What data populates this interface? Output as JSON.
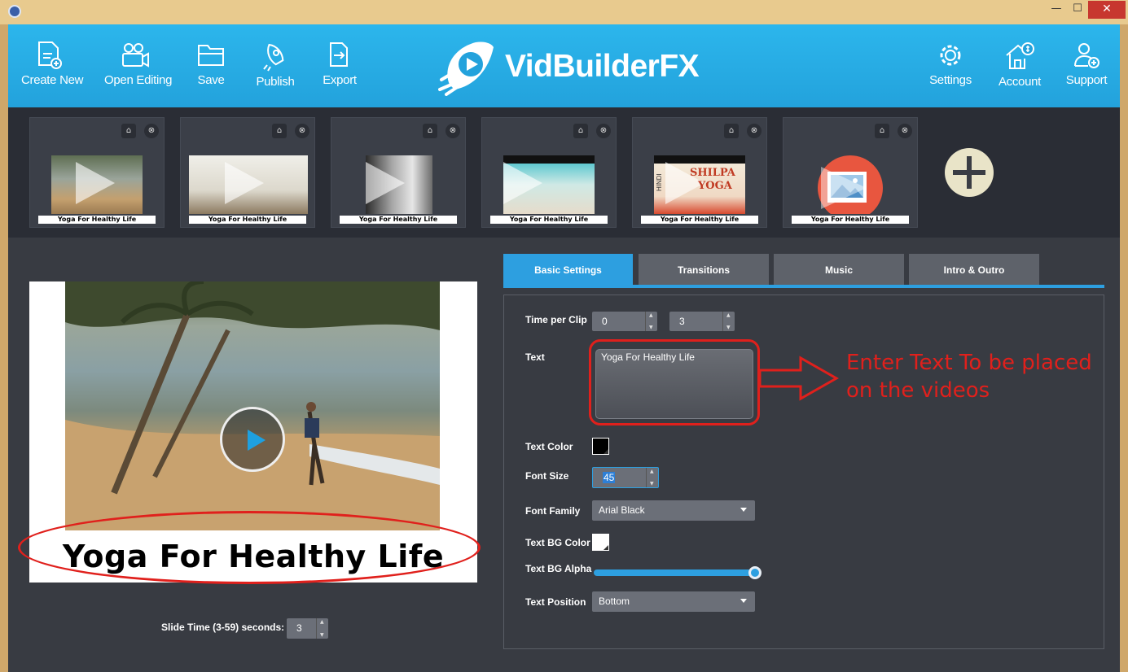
{
  "header": {
    "buttons_left": [
      "Create New",
      "Open Editing",
      "Save",
      "Publish",
      "Export"
    ],
    "buttons_right": [
      "Settings",
      "Account",
      "Support"
    ],
    "logo_text": "VidBuilderFX"
  },
  "clips": [
    {
      "caption": "Yoga For Healthy Life"
    },
    {
      "caption": "Yoga For Healthy Life"
    },
    {
      "caption": "Yoga For Healthy Life"
    },
    {
      "caption": "Yoga For Healthy Life"
    },
    {
      "caption": "Yoga For Healthy Life",
      "thumb_text_1": "SHILPA",
      "thumb_text_2": "YOGA",
      "thumb_text_3": "HINDI"
    },
    {
      "caption": "Yoga For Healthy Life"
    }
  ],
  "preview": {
    "caption": "Yoga For Healthy Life",
    "slide_time_label": "Slide Time (3-59) seconds:",
    "slide_time_value": "3"
  },
  "tabs": [
    "Basic Settings",
    "Transitions",
    "Music",
    "Intro & Outro"
  ],
  "active_tab": "Basic Settings",
  "settings": {
    "time_per_clip_label": "Time per Clip",
    "time_per_clip_min": "0",
    "time_per_clip_sec": "3",
    "text_label": "Text",
    "text_value": "Yoga For Healthy Life",
    "text_color_label": "Text Color",
    "text_color": "#000000",
    "font_size_label": "Font Size",
    "font_size": "45",
    "font_family_label": "Font Family",
    "font_family": "Arial Black",
    "text_bg_color_label": "Text BG Color",
    "text_bg_color": "#ffffff",
    "text_bg_alpha_label": "Text BG Alpha",
    "text_bg_alpha": 1.0,
    "text_position_label": "Text Position",
    "text_position": "Bottom"
  },
  "annotation": {
    "callout_text": "Enter Text To be placed on the videos"
  },
  "colors": {
    "header": "#23a2dc",
    "accent": "#2d9fe0",
    "annotation": "#e0201c",
    "panel": "#383b42"
  }
}
